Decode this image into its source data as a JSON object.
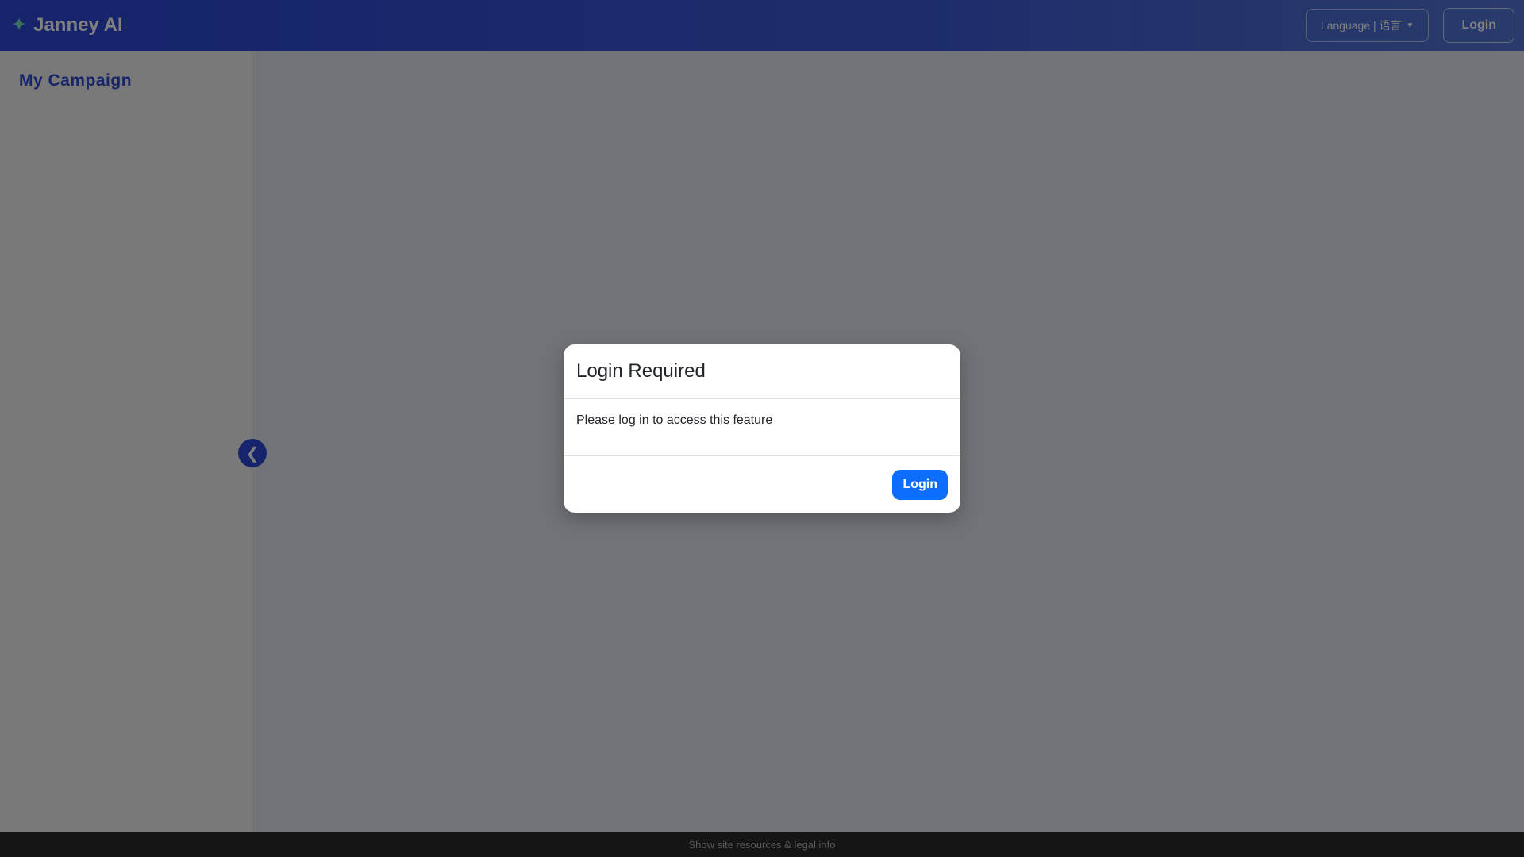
{
  "header": {
    "brand_icon": "✦",
    "brand_name": "Janney AI",
    "language_label": "Language | 语言",
    "login_label": "Login"
  },
  "sidebar": {
    "title": "My Campaign",
    "collapse_glyph": "❮"
  },
  "modal": {
    "title": "Login Required",
    "message": "Please log in to access this feature",
    "login_button": "Login"
  },
  "footer": {
    "link": "Show site resources & legal info"
  },
  "colors": {
    "primary": "#2a48d6",
    "modal_button": "#0d6efd",
    "footer_bg": "#2b2b2b"
  }
}
